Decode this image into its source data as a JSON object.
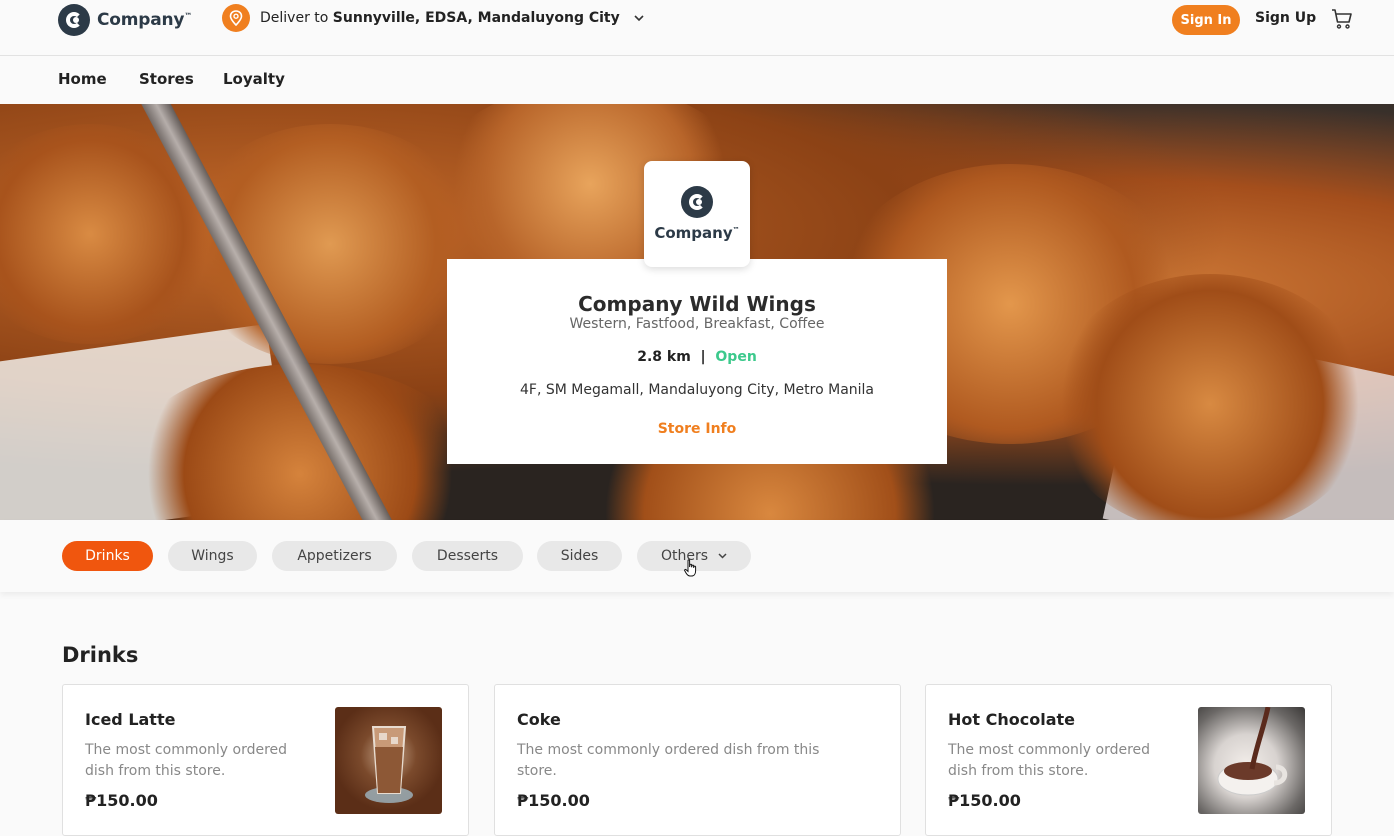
{
  "header": {
    "brand": "Company",
    "brand_tm": "™",
    "deliver_prefix": "Deliver to",
    "deliver_address": "Sunnyville, EDSA, Mandaluyong City",
    "sign_in": "Sign In",
    "sign_up": "Sign Up",
    "icons": [
      "location-pin-icon",
      "chevron-down-icon",
      "cart-icon"
    ],
    "accent_color": "#f07f1f"
  },
  "nav": {
    "items": [
      {
        "label": "Home"
      },
      {
        "label": "Stores"
      },
      {
        "label": "Loyalty"
      }
    ]
  },
  "store": {
    "logo_text": "Company",
    "logo_tm": "™",
    "name": "Company Wild Wings",
    "categories": "Western, Fastfood, Breakfast, Coffee",
    "distance": "2.8 km",
    "separator": "|",
    "status": "Open",
    "status_color": "#3cc98c",
    "address": "4F, SM Megamall, Mandaluyong City, Metro Manila",
    "info_link": "Store Info"
  },
  "tabs": {
    "items": [
      {
        "label": "Drinks",
        "active": true
      },
      {
        "label": "Wings"
      },
      {
        "label": "Appetizers"
      },
      {
        "label": "Desserts"
      },
      {
        "label": "Sides"
      },
      {
        "label": "Others"
      }
    ],
    "active_color": "#f0560e"
  },
  "section": {
    "title": "Drinks",
    "items": [
      {
        "name": "Iced Latte",
        "description": "The most commonly ordered dish from this store.",
        "price": "₱150.00",
        "image": "iced-latte-photo"
      },
      {
        "name": "Coke",
        "description": "The most commonly ordered dish from this store.",
        "price": "₱150.00"
      },
      {
        "name": "Hot Chocolate",
        "description": "The most commonly ordered dish from this store.",
        "price": "₱150.00",
        "image": "hot-chocolate-photo"
      }
    ]
  }
}
